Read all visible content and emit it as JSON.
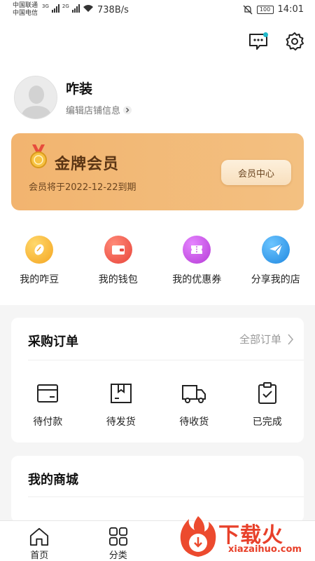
{
  "status_bar": {
    "carrier1": "中国联通",
    "carrier2": "中国电信",
    "net1": "3G",
    "net2": "2G",
    "speed": "738B/s",
    "battery": "100",
    "time": "14:01"
  },
  "header": {
    "shop_name": "咋装",
    "edit_label": "编辑店铺信息"
  },
  "vip": {
    "title": "金牌会员",
    "expire": "会员将于2022-12-22到期",
    "center_button": "会员中心",
    "colors": {
      "card": "#f2b46f",
      "title": "#5b3514"
    }
  },
  "quick_actions": [
    {
      "label": "我的咋豆",
      "icon": "bean-icon",
      "color": "#f6b52a"
    },
    {
      "label": "我的钱包",
      "icon": "wallet-icon",
      "color": "#ef5a4e"
    },
    {
      "label": "我的优惠券",
      "icon": "coupon-icon",
      "color": "#c24de0"
    },
    {
      "label": "分享我的店",
      "icon": "paper-plane-icon",
      "color": "#2d9be8"
    }
  ],
  "orders": {
    "title": "采购订单",
    "all_label": "全部订单",
    "items": [
      {
        "label": "待付款",
        "icon": "wallet-outline-icon"
      },
      {
        "label": "待发货",
        "icon": "package-icon"
      },
      {
        "label": "待收货",
        "icon": "truck-icon"
      },
      {
        "label": "已完成",
        "icon": "clipboard-check-icon"
      }
    ]
  },
  "mall": {
    "title": "我的商城"
  },
  "tabbar": [
    {
      "label": "首页",
      "icon": "home-icon"
    },
    {
      "label": "分类",
      "icon": "grid-icon"
    }
  ],
  "watermark": {
    "text": "下载火",
    "url": "xiazaihuo.com",
    "color": "#e8402a"
  }
}
